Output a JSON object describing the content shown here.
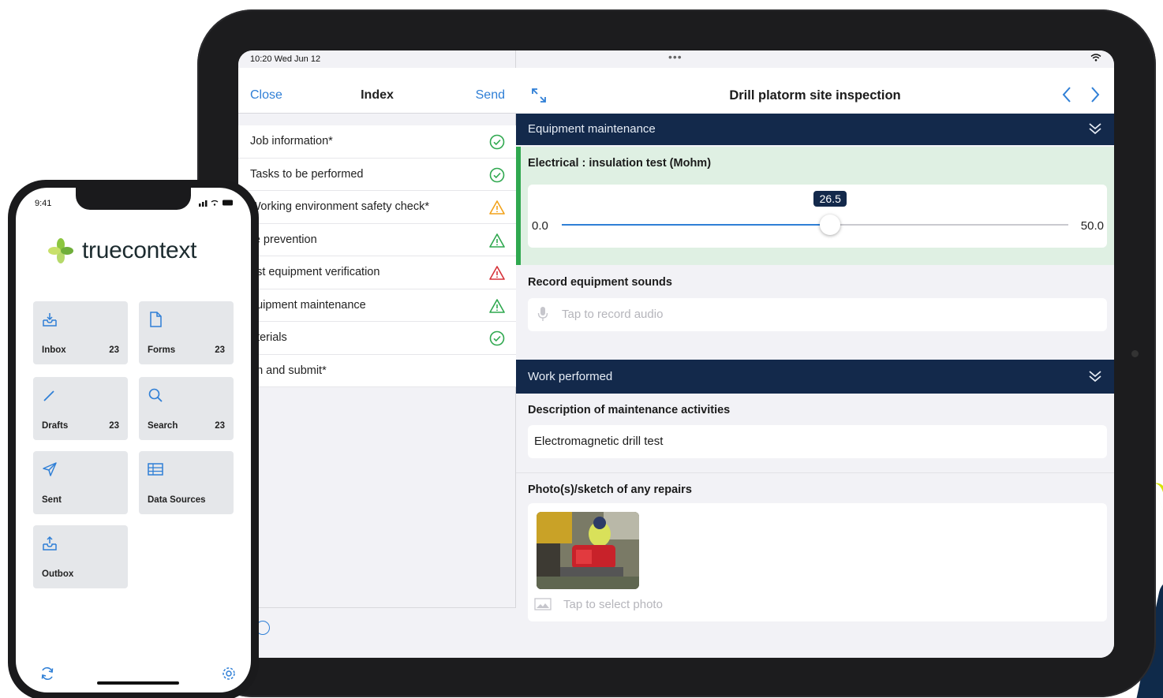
{
  "tablet": {
    "status": {
      "time": "10:20  Wed Jun 12",
      "dots": "•••"
    },
    "index": {
      "close_label": "Close",
      "title": "Index",
      "send_label": "Send",
      "items": [
        {
          "label": "Job information*",
          "status": "complete"
        },
        {
          "label": "Tasks to be performed",
          "status": "complete"
        },
        {
          "label": "Working environment safety check*",
          "status": "warning"
        },
        {
          "label": "re prevention",
          "status": "incomplete"
        },
        {
          "label": "est equipment verification",
          "status": "error"
        },
        {
          "label": "quipment maintenance",
          "status": "incomplete"
        },
        {
          "label": "aterials",
          "status": "complete"
        },
        {
          "label": "gn and submit*",
          "status": "none"
        }
      ]
    },
    "form": {
      "title": "Drill platorm site inspection",
      "sections": [
        {
          "title": "Equipment maintenance"
        },
        {
          "title": "Work performed"
        }
      ],
      "slider": {
        "label": "Electrical : insulation test (Mohm)",
        "min": "0.0",
        "max": "50.0",
        "value": "26.5",
        "fraction": 0.53
      },
      "sound": {
        "label": "Record equipment sounds",
        "placeholder": "Tap to record audio"
      },
      "description": {
        "label": "Description of maintenance activities",
        "value": "Electromagnetic drill test"
      },
      "photo": {
        "label": "Photo(s)/sketch of any repairs",
        "placeholder": "Tap to select photo"
      }
    }
  },
  "phone": {
    "time": "9:41",
    "brand": "truecontext",
    "tiles": [
      {
        "label": "Inbox",
        "count": "23",
        "icon": "inbox-icon"
      },
      {
        "label": "Forms",
        "count": "23",
        "icon": "document-icon"
      },
      {
        "label": "Drafts",
        "count": "23",
        "icon": "pencil-icon"
      },
      {
        "label": "Search",
        "count": "23",
        "icon": "search-icon"
      },
      {
        "label": "Sent",
        "count": "",
        "icon": "send-icon"
      },
      {
        "label": "Data Sources",
        "count": "",
        "icon": "table-icon"
      },
      {
        "label": "Outbox",
        "count": "",
        "icon": "outbox-icon"
      }
    ]
  },
  "colors": {
    "accent": "#2f7fd6",
    "section_bar": "#13294b",
    "success": "#2fa84f",
    "warning": "#f2a21b",
    "error": "#d6333a",
    "brand_green": "#8cc63f"
  }
}
